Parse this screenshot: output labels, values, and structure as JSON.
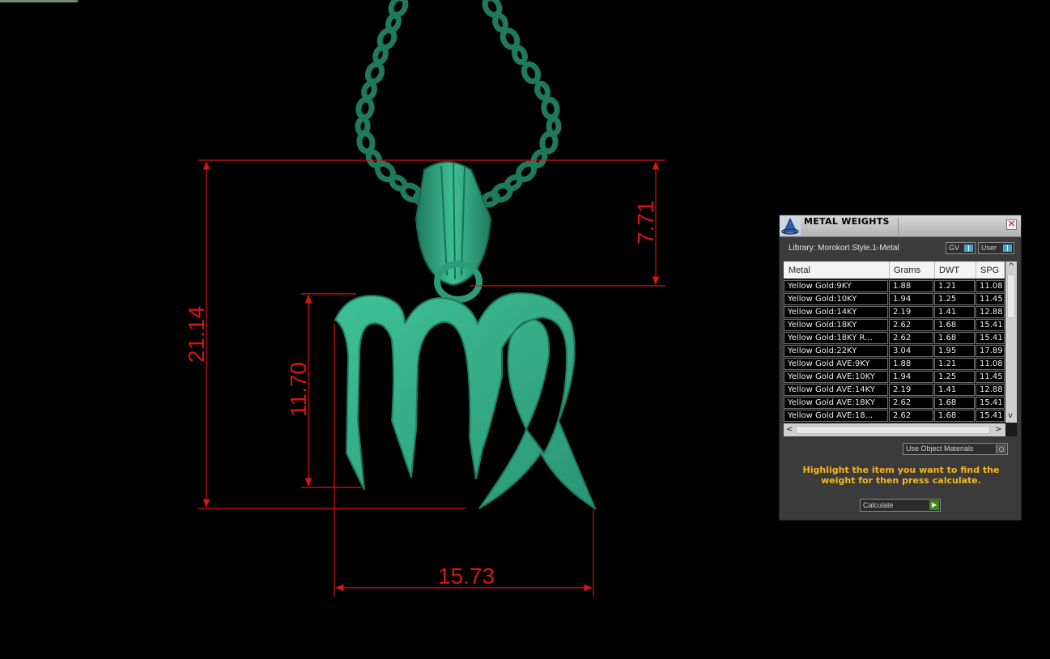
{
  "dimensions": {
    "height_label": "21.14",
    "bail_label": "7.71",
    "symbol_height_label": "11.70",
    "width_label": "15.73"
  },
  "colors": {
    "dimension_red": "#d81515",
    "model_green": "#33a882",
    "panel_bg": "#3b3b3b",
    "hint_yellow": "#f5b81f"
  },
  "panel": {
    "title": "METAL WEIGHTS",
    "close_icon": "close-icon",
    "library_label": "Library: Morokort Style.1-Metal",
    "toggle_gv": "GV",
    "toggle_user": "User",
    "columns": [
      "Metal",
      "Grams",
      "DWT",
      "SPG"
    ],
    "rows": [
      [
        "Yellow Gold:9KY",
        "1.88",
        "1.21",
        "11.08"
      ],
      [
        "Yellow Gold:10KY",
        "1.94",
        "1.25",
        "11.45"
      ],
      [
        "Yellow Gold:14KY",
        "2.19",
        "1.41",
        "12.88"
      ],
      [
        "Yellow Gold:18KY",
        "2.62",
        "1.68",
        "15.41"
      ],
      [
        "Yellow Gold:18KY R...",
        "2.62",
        "1.68",
        "15.41"
      ],
      [
        "Yellow Gold:22KY",
        "3.04",
        "1.95",
        "17.89"
      ],
      [
        "Yellow Gold AVE:9KY",
        "1.88",
        "1.21",
        "11.08"
      ],
      [
        "Yellow Gold AVE:10KY",
        "1.94",
        "1.25",
        "11.45"
      ],
      [
        "Yellow Gold AVE:14KY",
        "2.19",
        "1.41",
        "12.88"
      ],
      [
        "Yellow Gold AVE:18KY",
        "2.62",
        "1.68",
        "15.41"
      ],
      [
        "Yellow Gold AVE:18...",
        "2.62",
        "1.68",
        "15.41"
      ]
    ],
    "scroll_up": "^",
    "scroll_down": "v",
    "scroll_left": "<",
    "scroll_right": ">",
    "dropdown_label": "Use Object Materials",
    "hint": "Highlight the item you want to find the weight for then press calculate.",
    "calculate_label": "Calculate"
  }
}
